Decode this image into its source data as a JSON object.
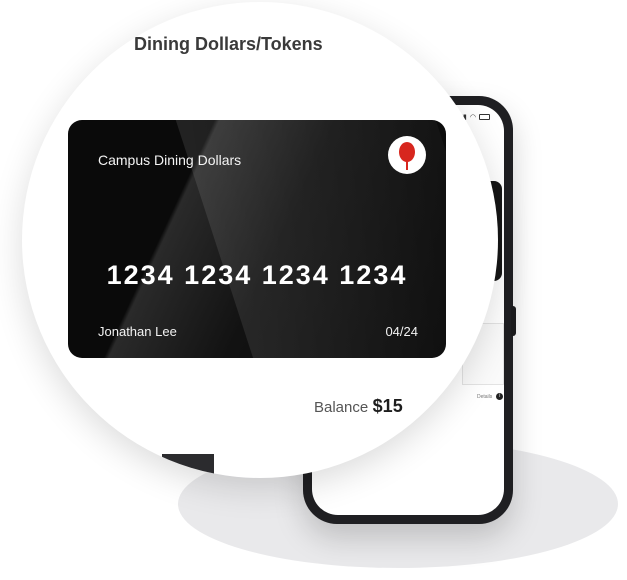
{
  "magnifier": {
    "title": "Dining Dollars/Tokens"
  },
  "card": {
    "name": "Campus Dining Dollars",
    "number": "1234 1234 1234 1234",
    "holder": "Jonathan Lee",
    "expiry": "04/24",
    "logo_icon": "spoon-icon",
    "logo_color": "#d7261e"
  },
  "balance": {
    "label": "Balance",
    "value": "$15"
  },
  "phone_screen": {
    "detail_text": "Details",
    "info_icon": "info-icon"
  }
}
